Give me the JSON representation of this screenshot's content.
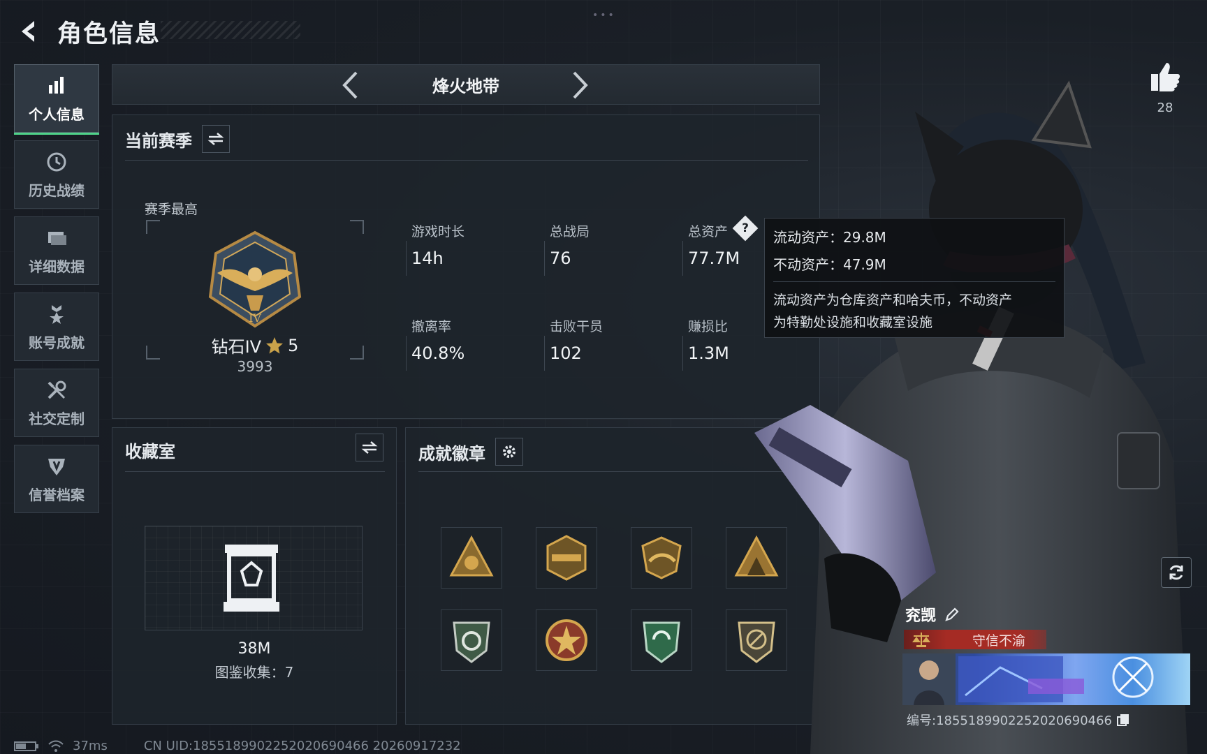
{
  "header": {
    "title": "角色信息"
  },
  "sidebar": {
    "items": [
      {
        "label": "个人信息",
        "icon": "bar-chart-icon",
        "active": true
      },
      {
        "label": "历史战绩",
        "icon": "clock-icon",
        "active": false
      },
      {
        "label": "详细数据",
        "icon": "folder-icon",
        "active": false
      },
      {
        "label": "账号成就",
        "icon": "medal-icon",
        "active": false
      },
      {
        "label": "社交定制",
        "icon": "wrench-icon",
        "active": false
      },
      {
        "label": "信誉档案",
        "icon": "shield-icon",
        "active": false
      }
    ]
  },
  "mode": {
    "title": "烽火地带"
  },
  "season": {
    "title": "当前赛季",
    "best_label": "赛季最高",
    "rank_name": "钻石IV",
    "rank_stars": "5",
    "rank_score": "3993",
    "stats": [
      {
        "label": "游戏时长",
        "value": "14h"
      },
      {
        "label": "总战局",
        "value": "76"
      },
      {
        "label": "总资产",
        "value": "77.7M"
      },
      {
        "label": "撤离率",
        "value": "40.8%"
      },
      {
        "label": "击败干员",
        "value": "102"
      },
      {
        "label": "赚损比",
        "value": "1.3M"
      }
    ]
  },
  "tooltip": {
    "liquid": "流动资产：29.8M",
    "fixed": "不动资产：47.9M",
    "desc_line1": "流动资产为仓库资产和哈夫币，不动资产",
    "desc_line2": "为特勤处设施和收藏室设施"
  },
  "collection": {
    "title": "收藏室",
    "value": "38M",
    "count": "图鉴收集：7"
  },
  "badges": {
    "title": "成就徽章",
    "count_shown": 8
  },
  "profile": {
    "likes": "28",
    "nickname": "兖觊",
    "title_tag": "守信不渝",
    "uid": "编号:1855189902252020690466"
  },
  "status": {
    "ping": "37ms",
    "uid_line": "CN UID:1855189902252020690466 20260917232"
  },
  "colors": {
    "accent_green": "#4fd48a",
    "tag_red": "#a52b24",
    "gold": "#c9a24a",
    "panel_bg": "#1e242b"
  }
}
